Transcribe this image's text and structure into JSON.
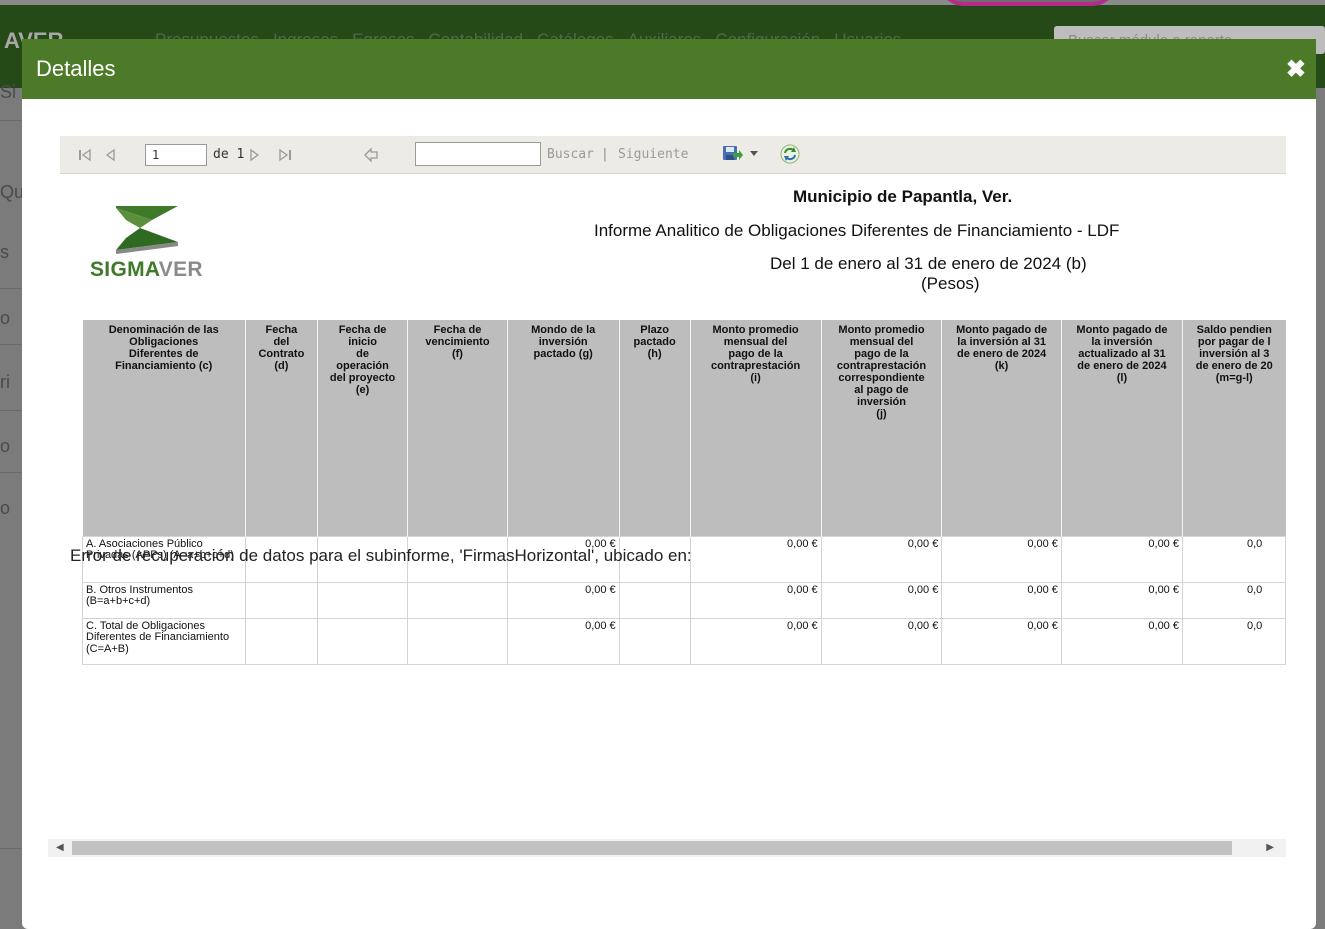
{
  "background_app": {
    "brand": "AVER",
    "menu": [
      "Presupuestos",
      "Ingresos",
      "Egresos",
      "Contabilidad",
      "Catálogos",
      "Auxiliares",
      "Configuración",
      "Usuarios"
    ],
    "search_placeholder": "Buscar módulo o reporte",
    "side_letters": [
      "Si",
      "Qu",
      "s",
      "o",
      "ri",
      "o",
      "o"
    ]
  },
  "modal": {
    "title": "Detalles",
    "close_glyph": "✖"
  },
  "toolbar": {
    "current_page": "1",
    "page_of": "de 1",
    "find_value": "",
    "find_label": "Buscar",
    "separator": "|",
    "next_label": "Siguiente",
    "colors": {
      "bg": "#ecebe6",
      "accent": "#4d7a28"
    }
  },
  "report": {
    "logo_text_green": "SIGMA",
    "logo_text_gray": "VER",
    "entity": "Municipio de Papantla, Ver.",
    "report_title": "Informe Analitico de Obligaciones Diferentes de Financiamiento - LDF",
    "period": "Del 1 de enero al  31 de enero de 2024 (b)",
    "units": "(Pesos)",
    "columns": [
      "Denominación de las\nObligaciones\nDiferentes de\nFinanciamiento (c)",
      "Fecha\ndel\nContrato\n(d)",
      "Fecha de\ninicio\nde\noperación\ndel proyecto\n(e)",
      "Fecha de\nvencimiento\n(f)",
      "Mondo de la\ninversión\npactado (g)",
      "Plazo\npactado\n(h)",
      "Monto promedio\nmensual del\npago de la\ncontraprestación\n(i)",
      "Monto promedio\nmensual del\npago de la\ncontraprestación\ncorrespondiente\nal pago de\ninversión\n(j)",
      "Monto pagado de\nla inversión al  31\nde enero de 2024\n(k)",
      "Monto pagado de\nla inversión\nactualizado al  31\nde enero de 2024\n(l)",
      "Saldo pendien\npor pagar de l\ninversión al  3\nde enero de 20\n(m=g-l)"
    ],
    "rows": [
      {
        "label": "A. Asociaciones Público Privadas (APPs) (A=a+b+c+d)",
        "d": "",
        "e": "",
        "f": "",
        "g": "0,00 €",
        "h": "",
        "i": "0,00 €",
        "j": "0,00 €",
        "k": "0,00 €",
        "l": "0,00 €",
        "m": "0,0"
      },
      {
        "label": "B. Otros Instrumentos (B=a+b+c+d)",
        "d": "",
        "e": "",
        "f": "",
        "g": "0,00 €",
        "h": "",
        "i": "0,00 €",
        "j": "0,00 €",
        "k": "0,00 €",
        "l": "0,00 €",
        "m": "0,0"
      },
      {
        "label": "C. Total de Obligaciones Diferentes de Financiamiento (C=A+B)",
        "d": "",
        "e": "",
        "f": "",
        "g": "0,00 €",
        "h": "",
        "i": "0,00 €",
        "j": "0,00 €",
        "k": "0,00 €",
        "l": "0,00 €",
        "m": "0,0"
      }
    ],
    "error_message": "Error de recuperación de datos para el subinforme, 'FirmasHorizontal', ubicado en:"
  }
}
